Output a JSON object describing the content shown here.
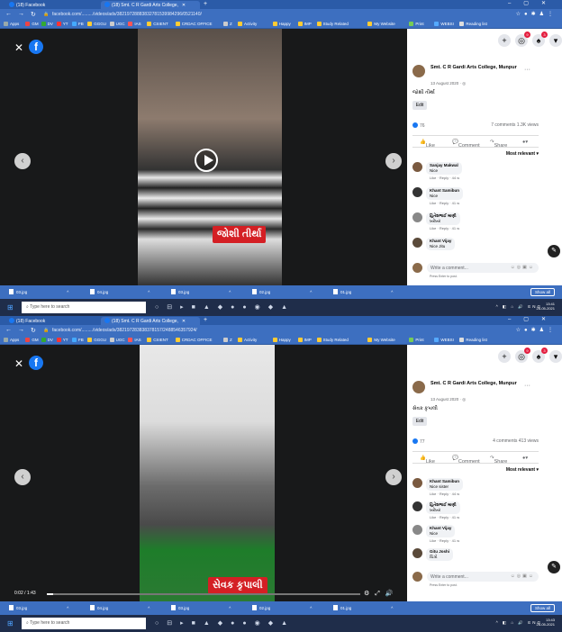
{
  "screens": [
    {
      "tabs": [
        {
          "label": "(18) Facebook"
        },
        {
          "label": "(18) Smt. C R Gardi Arts College,"
        }
      ],
      "url": "facebook.com/........./videos/ads/38219728883832781539984296/0521140/",
      "bookmarks": [
        "Apps",
        "GM",
        "DV",
        "YT",
        "FB",
        "GGGU",
        "UGC",
        "IAS",
        "CSIENT",
        "CRDAC OFFICE",
        "Z",
        "Activity",
        "Happy",
        "IMP",
        "Study Related",
        "My Website",
        "Print",
        "WEBSI",
        "Reading list"
      ],
      "caption": "જોશી તીર્થા",
      "progress": {
        "time": "",
        "fraction": 0
      },
      "post": {
        "page_name": "Smt. C R Gardi Arts College, Munpur",
        "date": "13 August 2020 · ◎",
        "text": "જોશી તીર્થા",
        "edit_label": "Edit",
        "likes": "76",
        "stats_right": "7 comments 1.3K views",
        "like_label": "Like",
        "comment_label": "Comment",
        "share_label": "Share",
        "relevance_label": "Most relevant ▾",
        "comments": [
          {
            "name": "Sanjay Makwal",
            "text": "Nice",
            "meta": "Like · Reply · 44 w"
          },
          {
            "name": "Khant Samibun",
            "text": "Nice",
            "meta": "Like · Reply · 41 w"
          },
          {
            "name": "હિતેશભાઈ માણી",
            "text": "ખરેખર",
            "meta": "Like · Reply · 41 w"
          },
          {
            "name": "Khant Vijay",
            "text": "Nice Jitu",
            "meta": ""
          }
        ],
        "write_placeholder": "Write a comment...",
        "hint": "Press Enter to post."
      },
      "downloads": [
        "03.jpg",
        "04.jpg",
        "03.jpg",
        "02.jpg",
        "01.jpg"
      ],
      "show_all": "Show all",
      "taskbar_search": "Type here to search",
      "clock": {
        "time": "13:41",
        "date": "26-05-2021"
      }
    },
    {
      "tabs": [
        {
          "label": "(18) Facebook"
        },
        {
          "label": "(18) Smt. C R Gardi Arts College,"
        }
      ],
      "url": "facebook.com/........./videos/ads/382197283838378157/2488546357924/",
      "bookmarks": [
        "Apps",
        "GM",
        "DV",
        "YT",
        "FB",
        "GGGU",
        "UGC",
        "IAS",
        "CSIENT",
        "CRDAC OFFICE",
        "Z",
        "Activity",
        "Happy",
        "IMP",
        "Study Related",
        "My Website",
        "Print",
        "WEBSI",
        "Reading list"
      ],
      "caption": "સેવક કૃપાલી",
      "progress": {
        "time": "0:02 / 1:43",
        "fraction": 0.02
      },
      "post": {
        "page_name": "Smt. C R Gardi Arts College, Munpur",
        "date": "13 August 2020 · ◎",
        "text": "સેવક કૃપાલી",
        "edit_label": "Edit",
        "likes": "77",
        "stats_right": "4 comments 413 views",
        "like_label": "Like",
        "comment_label": "Comment",
        "share_label": "Share",
        "relevance_label": "Most relevant ▾",
        "comments": [
          {
            "name": "Khant Samibun",
            "text": "Nice sister",
            "meta": "Like · Reply · 44 w"
          },
          {
            "name": "હિતેશભાઈ માણી",
            "text": "ખરેખર",
            "meta": "Like · Reply · 41 w"
          },
          {
            "name": "Khant Vijay",
            "text": "Nice",
            "meta": "Like · Reply · 41 w"
          },
          {
            "name": "Gitu Joshi",
            "text": "ચિત્રો",
            "meta": ""
          }
        ],
        "write_placeholder": "Write a comment...",
        "hint": "Press Enter to post."
      },
      "downloads": [
        "03.jpg",
        "04.jpg",
        "03.jpg",
        "02.jpg",
        "01.jpg"
      ],
      "show_all": "Show all",
      "taskbar_search": "Type here to search",
      "clock": {
        "time": "13:43",
        "date": "26-05-2021"
      }
    }
  ],
  "colors": {
    "facebook_blue": "#1877f2",
    "chrome_blue": "#3d6fc0",
    "caption_red": "#d41f24",
    "taskbar": "#1f2d4a"
  }
}
